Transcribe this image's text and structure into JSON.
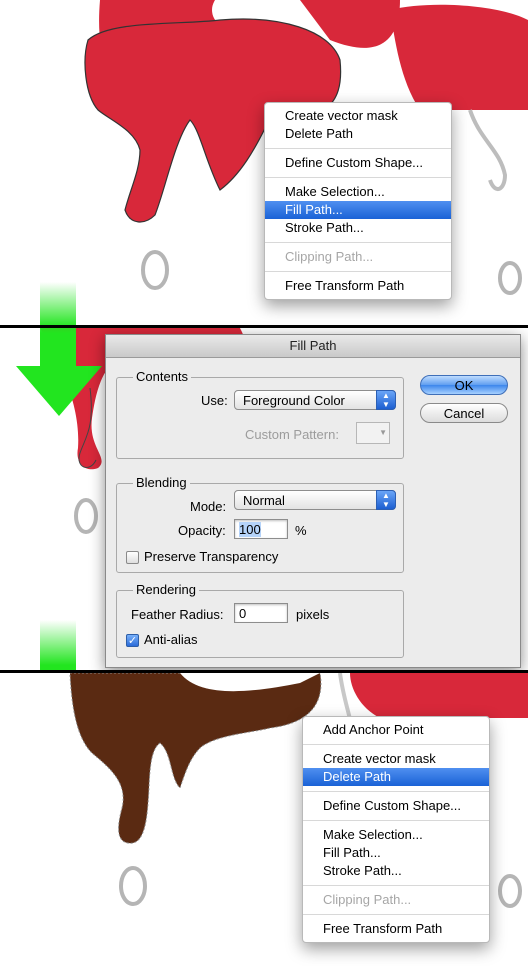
{
  "context_menu_1": {
    "items": [
      {
        "label": "Create vector mask",
        "state": "normal"
      },
      {
        "label": "Delete Path",
        "state": "normal"
      },
      {
        "sep": true
      },
      {
        "label": "Define Custom Shape...",
        "state": "normal"
      },
      {
        "sep": true
      },
      {
        "label": "Make Selection...",
        "state": "normal"
      },
      {
        "label": "Fill Path...",
        "state": "selected"
      },
      {
        "label": "Stroke Path...",
        "state": "normal"
      },
      {
        "sep": true
      },
      {
        "label": "Clipping Path...",
        "state": "disabled"
      },
      {
        "sep": true
      },
      {
        "label": "Free Transform Path",
        "state": "normal"
      }
    ]
  },
  "dialog": {
    "title": "Fill Path",
    "contents": {
      "group_label": "Contents",
      "use_label": "Use:",
      "use_value": "Foreground Color",
      "custom_pattern_label": "Custom Pattern:"
    },
    "blending": {
      "group_label": "Blending",
      "mode_label": "Mode:",
      "mode_value": "Normal",
      "opacity_label": "Opacity:",
      "opacity_value": "100",
      "opacity_unit": "%",
      "preserve_label": "Preserve Transparency",
      "preserve_checked": false
    },
    "rendering": {
      "group_label": "Rendering",
      "feather_label": "Feather Radius:",
      "feather_value": "0",
      "feather_unit": "pixels",
      "antialias_label": "Anti-alias",
      "antialias_checked": true
    },
    "ok_label": "OK",
    "cancel_label": "Cancel"
  },
  "context_menu_2": {
    "items": [
      {
        "label": "Add Anchor Point",
        "state": "normal"
      },
      {
        "sep": true
      },
      {
        "label": "Create vector mask",
        "state": "normal"
      },
      {
        "label": "Delete Path",
        "state": "selected"
      },
      {
        "sep": true
      },
      {
        "label": "Define Custom Shape...",
        "state": "normal"
      },
      {
        "sep": true
      },
      {
        "label": "Make Selection...",
        "state": "normal"
      },
      {
        "label": "Fill Path...",
        "state": "normal"
      },
      {
        "label": "Stroke Path...",
        "state": "normal"
      },
      {
        "sep": true
      },
      {
        "label": "Clipping Path...",
        "state": "disabled"
      },
      {
        "sep": true
      },
      {
        "label": "Free Transform Path",
        "state": "normal"
      }
    ]
  },
  "colors": {
    "letter_red": "#d8283a",
    "fill_brown": "#5a2a12",
    "arrow_green": "#22e51f",
    "menu_highlight": "#1f6ddf"
  },
  "icons": [
    "down-arrow-icon",
    "checkmark-icon",
    "stepper-icon"
  ]
}
